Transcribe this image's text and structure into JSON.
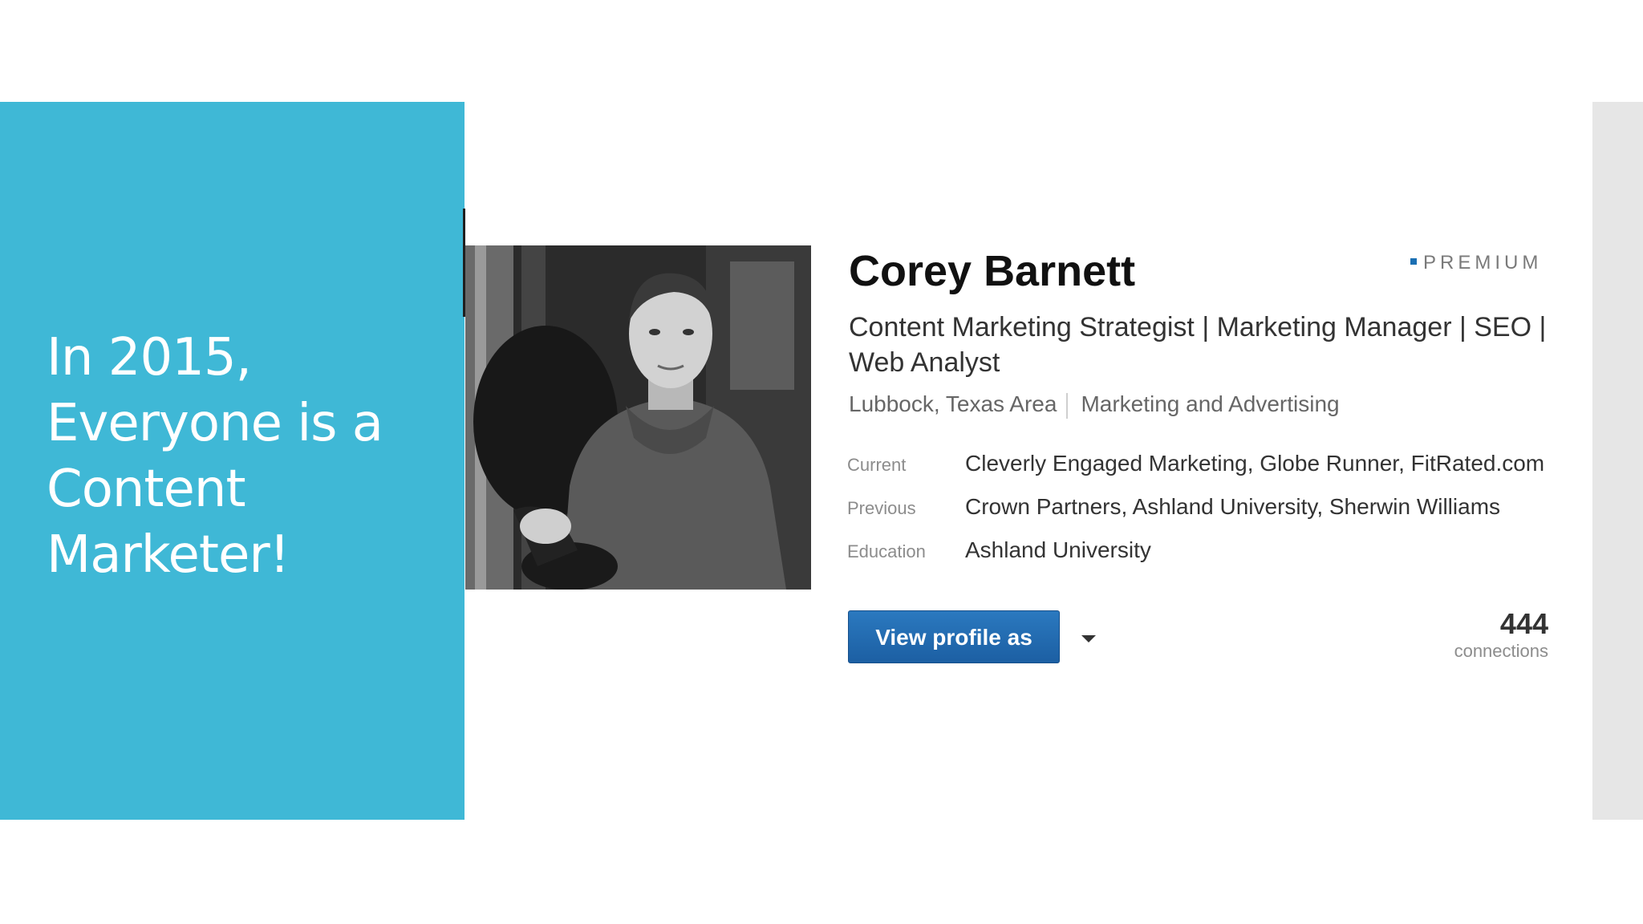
{
  "slide": {
    "title_lines": [
      "In 2015,",
      "Everyone is a",
      "Content",
      "Marketer!"
    ]
  },
  "profile": {
    "name": "Corey Barnett",
    "badge": "PREMIUM",
    "headline": "Content Marketing Strategist | Marketing Manager | SEO | Web Analyst",
    "location": "Lubbock, Texas Area",
    "industry": "Marketing and Advertising",
    "details": [
      {
        "label": "Current",
        "value": "Cleverly Engaged Marketing, Globe Runner, FitRated.com"
      },
      {
        "label": "Previous",
        "value": "Crown Partners, Ashland University, Sherwin Williams"
      },
      {
        "label": "Education",
        "value": "Ashland University"
      }
    ],
    "view_button": "View profile as",
    "connections_count": "444",
    "connections_label": "connections",
    "photo_icon": "profile-photo"
  },
  "colors": {
    "panel": "#3fb8d6",
    "button": "#1f65ab",
    "premium_square": "#1a6fb3",
    "side_strip": "#e6e6e6"
  }
}
